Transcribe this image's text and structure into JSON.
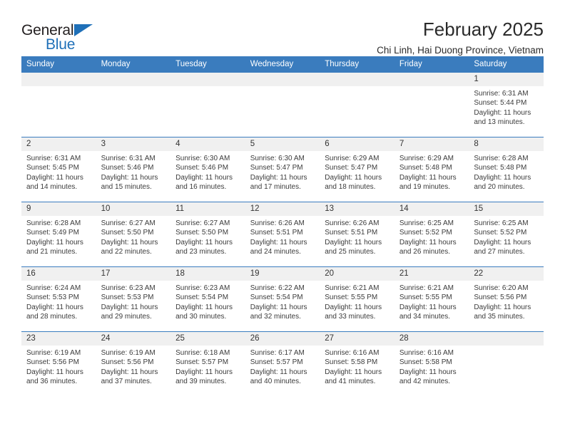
{
  "logo": {
    "word1": "General",
    "word2": "Blue",
    "triangle_color": "#1f70b8"
  },
  "header": {
    "title": "February 2025",
    "subtitle": "Chi Linh, Hai Duong Province, Vietnam"
  },
  "theme": {
    "header_bg": "#3a7cbe",
    "daynum_bg": "#f0f0f0",
    "text": "#3b3b3b"
  },
  "calendar": {
    "weekday_headers": [
      "Sunday",
      "Monday",
      "Tuesday",
      "Wednesday",
      "Thursday",
      "Friday",
      "Saturday"
    ],
    "weeks": [
      [
        {
          "day": "",
          "sunrise": "",
          "sunset": "",
          "daylight": ""
        },
        {
          "day": "",
          "sunrise": "",
          "sunset": "",
          "daylight": ""
        },
        {
          "day": "",
          "sunrise": "",
          "sunset": "",
          "daylight": ""
        },
        {
          "day": "",
          "sunrise": "",
          "sunset": "",
          "daylight": ""
        },
        {
          "day": "",
          "sunrise": "",
          "sunset": "",
          "daylight": ""
        },
        {
          "day": "",
          "sunrise": "",
          "sunset": "",
          "daylight": ""
        },
        {
          "day": "1",
          "sunrise": "Sunrise: 6:31 AM",
          "sunset": "Sunset: 5:44 PM",
          "daylight": "Daylight: 11 hours and 13 minutes."
        }
      ],
      [
        {
          "day": "2",
          "sunrise": "Sunrise: 6:31 AM",
          "sunset": "Sunset: 5:45 PM",
          "daylight": "Daylight: 11 hours and 14 minutes."
        },
        {
          "day": "3",
          "sunrise": "Sunrise: 6:31 AM",
          "sunset": "Sunset: 5:46 PM",
          "daylight": "Daylight: 11 hours and 15 minutes."
        },
        {
          "day": "4",
          "sunrise": "Sunrise: 6:30 AM",
          "sunset": "Sunset: 5:46 PM",
          "daylight": "Daylight: 11 hours and 16 minutes."
        },
        {
          "day": "5",
          "sunrise": "Sunrise: 6:30 AM",
          "sunset": "Sunset: 5:47 PM",
          "daylight": "Daylight: 11 hours and 17 minutes."
        },
        {
          "day": "6",
          "sunrise": "Sunrise: 6:29 AM",
          "sunset": "Sunset: 5:47 PM",
          "daylight": "Daylight: 11 hours and 18 minutes."
        },
        {
          "day": "7",
          "sunrise": "Sunrise: 6:29 AM",
          "sunset": "Sunset: 5:48 PM",
          "daylight": "Daylight: 11 hours and 19 minutes."
        },
        {
          "day": "8",
          "sunrise": "Sunrise: 6:28 AM",
          "sunset": "Sunset: 5:48 PM",
          "daylight": "Daylight: 11 hours and 20 minutes."
        }
      ],
      [
        {
          "day": "9",
          "sunrise": "Sunrise: 6:28 AM",
          "sunset": "Sunset: 5:49 PM",
          "daylight": "Daylight: 11 hours and 21 minutes."
        },
        {
          "day": "10",
          "sunrise": "Sunrise: 6:27 AM",
          "sunset": "Sunset: 5:50 PM",
          "daylight": "Daylight: 11 hours and 22 minutes."
        },
        {
          "day": "11",
          "sunrise": "Sunrise: 6:27 AM",
          "sunset": "Sunset: 5:50 PM",
          "daylight": "Daylight: 11 hours and 23 minutes."
        },
        {
          "day": "12",
          "sunrise": "Sunrise: 6:26 AM",
          "sunset": "Sunset: 5:51 PM",
          "daylight": "Daylight: 11 hours and 24 minutes."
        },
        {
          "day": "13",
          "sunrise": "Sunrise: 6:26 AM",
          "sunset": "Sunset: 5:51 PM",
          "daylight": "Daylight: 11 hours and 25 minutes."
        },
        {
          "day": "14",
          "sunrise": "Sunrise: 6:25 AM",
          "sunset": "Sunset: 5:52 PM",
          "daylight": "Daylight: 11 hours and 26 minutes."
        },
        {
          "day": "15",
          "sunrise": "Sunrise: 6:25 AM",
          "sunset": "Sunset: 5:52 PM",
          "daylight": "Daylight: 11 hours and 27 minutes."
        }
      ],
      [
        {
          "day": "16",
          "sunrise": "Sunrise: 6:24 AM",
          "sunset": "Sunset: 5:53 PM",
          "daylight": "Daylight: 11 hours and 28 minutes."
        },
        {
          "day": "17",
          "sunrise": "Sunrise: 6:23 AM",
          "sunset": "Sunset: 5:53 PM",
          "daylight": "Daylight: 11 hours and 29 minutes."
        },
        {
          "day": "18",
          "sunrise": "Sunrise: 6:23 AM",
          "sunset": "Sunset: 5:54 PM",
          "daylight": "Daylight: 11 hours and 30 minutes."
        },
        {
          "day": "19",
          "sunrise": "Sunrise: 6:22 AM",
          "sunset": "Sunset: 5:54 PM",
          "daylight": "Daylight: 11 hours and 32 minutes."
        },
        {
          "day": "20",
          "sunrise": "Sunrise: 6:21 AM",
          "sunset": "Sunset: 5:55 PM",
          "daylight": "Daylight: 11 hours and 33 minutes."
        },
        {
          "day": "21",
          "sunrise": "Sunrise: 6:21 AM",
          "sunset": "Sunset: 5:55 PM",
          "daylight": "Daylight: 11 hours and 34 minutes."
        },
        {
          "day": "22",
          "sunrise": "Sunrise: 6:20 AM",
          "sunset": "Sunset: 5:56 PM",
          "daylight": "Daylight: 11 hours and 35 minutes."
        }
      ],
      [
        {
          "day": "23",
          "sunrise": "Sunrise: 6:19 AM",
          "sunset": "Sunset: 5:56 PM",
          "daylight": "Daylight: 11 hours and 36 minutes."
        },
        {
          "day": "24",
          "sunrise": "Sunrise: 6:19 AM",
          "sunset": "Sunset: 5:56 PM",
          "daylight": "Daylight: 11 hours and 37 minutes."
        },
        {
          "day": "25",
          "sunrise": "Sunrise: 6:18 AM",
          "sunset": "Sunset: 5:57 PM",
          "daylight": "Daylight: 11 hours and 39 minutes."
        },
        {
          "day": "26",
          "sunrise": "Sunrise: 6:17 AM",
          "sunset": "Sunset: 5:57 PM",
          "daylight": "Daylight: 11 hours and 40 minutes."
        },
        {
          "day": "27",
          "sunrise": "Sunrise: 6:16 AM",
          "sunset": "Sunset: 5:58 PM",
          "daylight": "Daylight: 11 hours and 41 minutes."
        },
        {
          "day": "28",
          "sunrise": "Sunrise: 6:16 AM",
          "sunset": "Sunset: 5:58 PM",
          "daylight": "Daylight: 11 hours and 42 minutes."
        },
        {
          "day": "",
          "sunrise": "",
          "sunset": "",
          "daylight": ""
        }
      ]
    ]
  }
}
